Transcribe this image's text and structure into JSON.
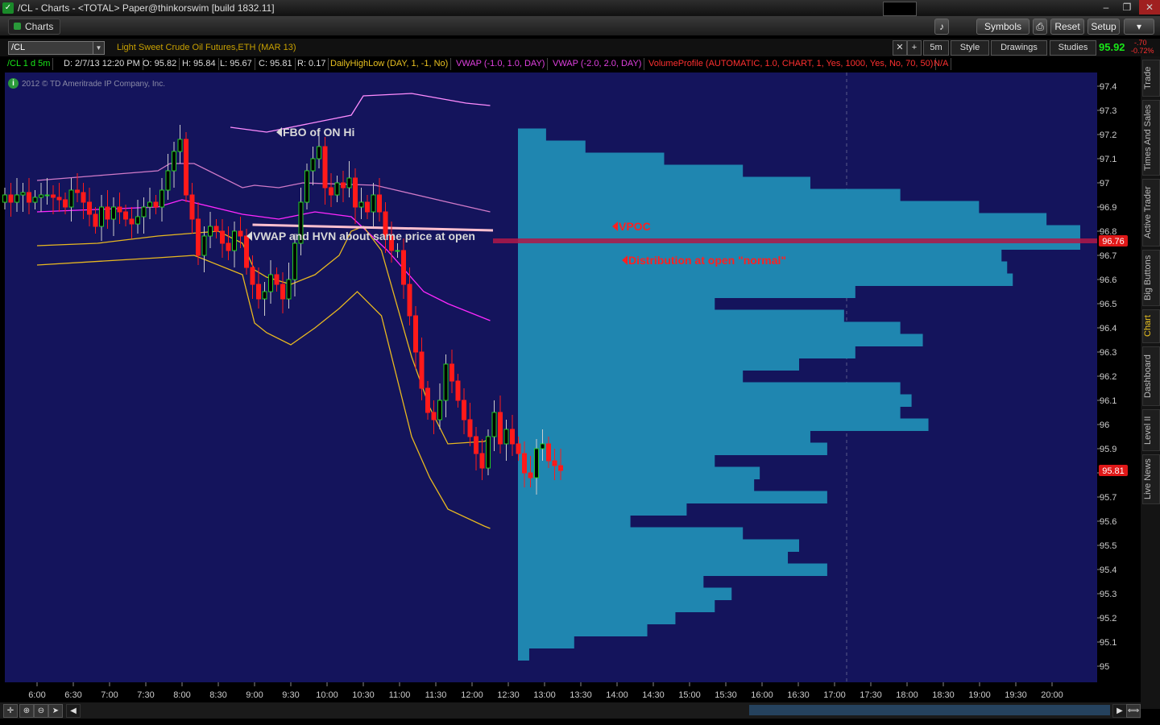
{
  "window": {
    "title": "/CL - Charts - <TOTAL> Paper@thinkorswim [build 1832.11]",
    "minimize": "–",
    "restore": "❐",
    "close": "✕"
  },
  "toolbar": {
    "charts_tab": "Charts",
    "symbols": "Symbols",
    "reset": "Reset",
    "setup": "Setup"
  },
  "chart_header": {
    "symbol": "/CL",
    "description": "Light Sweet Crude Oil Futures,ETH (MAR 13)",
    "interval": "5m",
    "style": "Style",
    "drawings": "Drawings",
    "studies": "Studies",
    "last_price": "95.92",
    "change": "-.70",
    "change_pct": "-0.72%"
  },
  "info_bar": {
    "period": "/CL 1 d 5m",
    "date": "D: 2/7/13 12:20 PM",
    "open": "O: 95.82",
    "high": "H: 95.84",
    "low": "L: 95.67",
    "close": "C: 95.81",
    "range": "R: 0.17",
    "study1": "DailyHighLow (DAY, 1, -1, No)",
    "study2": "VWAP (-1.0, 1.0, DAY)",
    "study3": "VWAP (-2.0, 2.0, DAY)",
    "study4": "VolumeProfile (AUTOMATIC, 1.0, CHART, 1, Yes, 1000, Yes, No, 70, 50)",
    "study5": "N/A"
  },
  "copyright": "2012 © TD Ameritrade IP Company, Inc.",
  "side_tabs": [
    "Trade",
    "Times And Sales",
    "Active Trader",
    "Big Buttons",
    "Chart",
    "Dashboard",
    "Level II",
    "Live News"
  ],
  "chart_data": {
    "type": "candlestick",
    "title": "",
    "ylim": [
      94.98,
      97.43
    ],
    "y_ticks": [
      "97.4",
      "97.3",
      "97.2",
      "97.1",
      "97",
      "96.9",
      "96.8",
      "96.7",
      "96.6",
      "96.5",
      "96.4",
      "96.3",
      "96.2",
      "96.1",
      "96",
      "95.9",
      "95.8",
      "95.7",
      "95.6",
      "95.5",
      "95.4",
      "95.3",
      "95.2",
      "95.1",
      "95"
    ],
    "x_ticks": [
      "6:00",
      "6:30",
      "7:00",
      "7:30",
      "8:00",
      "8:30",
      "9:00",
      "9:30",
      "10:00",
      "10:30",
      "11:00",
      "11:30",
      "12:00",
      "12:30",
      "13:00",
      "13:30",
      "14:00",
      "14:30",
      "15:00",
      "15:30",
      "16:00",
      "16:30",
      "17:00",
      "17:30",
      "18:00",
      "18:30",
      "19:00",
      "19:30",
      "20:00"
    ],
    "time_start": "6:00",
    "bar_minutes": 5,
    "current_price_label": "96.76",
    "last_price_label": "95.81",
    "closes": [
      96.95,
      96.92,
      96.95,
      96.96,
      96.92,
      96.94,
      96.95,
      96.95,
      96.94,
      96.93,
      96.9,
      96.97,
      96.96,
      96.92,
      96.87,
      96.82,
      96.9,
      96.85,
      96.9,
      96.88,
      96.85,
      96.83,
      96.86,
      96.9,
      96.92,
      96.9,
      96.97,
      97.05,
      97.13,
      97.18,
      96.95,
      96.85,
      96.7,
      96.78,
      96.82,
      96.8,
      96.75,
      96.72,
      96.8,
      96.78,
      96.65,
      96.58,
      96.52,
      96.55,
      96.62,
      96.58,
      96.52,
      96.6,
      96.75,
      96.92,
      97.05,
      97.1,
      97.15,
      96.98,
      96.95,
      97.0,
      96.98,
      97.02,
      96.9,
      96.92,
      96.88,
      96.95,
      96.88,
      96.78,
      96.72,
      96.72,
      96.58,
      96.45,
      96.3,
      96.15,
      96.05,
      96.02,
      96.1,
      96.25,
      96.18,
      96.1,
      96.02,
      95.95,
      95.88,
      95.82,
      95.95,
      96.05,
      95.92,
      95.98,
      95.92,
      95.88,
      95.8,
      95.78,
      95.9,
      95.92,
      95.85,
      95.83,
      95.81
    ],
    "series": [
      {
        "name": "",
        "color": "#ff8cff",
        "values": [
          [
            32,
            97.23
          ],
          [
            38,
            97.21
          ],
          [
            52,
            97.28
          ],
          [
            54,
            97.36
          ],
          [
            62,
            97.37
          ],
          [
            71,
            97.33
          ],
          [
            75,
            97.32
          ]
        ]
      },
      {
        "name": "",
        "color": "#d07ac8",
        "values": [
          [
            0,
            97.01
          ],
          [
            10,
            97.03
          ],
          [
            20,
            97.05
          ],
          [
            22,
            97.08
          ],
          [
            26,
            97.08
          ],
          [
            34,
            96.98
          ],
          [
            36,
            96.99
          ],
          [
            40,
            96.98
          ],
          [
            44,
            97.0
          ],
          [
            56,
            96.99
          ],
          [
            68,
            96.92
          ],
          [
            75,
            96.88
          ]
        ]
      },
      {
        "name": "",
        "color": "#ff28ff",
        "values": [
          [
            0,
            96.88
          ],
          [
            10,
            96.89
          ],
          [
            20,
            96.9
          ],
          [
            24,
            96.93
          ],
          [
            34,
            96.87
          ],
          [
            40,
            96.85
          ],
          [
            46,
            96.88
          ],
          [
            52,
            96.86
          ],
          [
            58,
            96.72
          ],
          [
            64,
            96.55
          ],
          [
            68,
            96.5
          ],
          [
            75,
            96.43
          ]
        ]
      },
      {
        "name": "",
        "color": "#e8b820",
        "values": [
          [
            0,
            96.74
          ],
          [
            10,
            96.75
          ],
          [
            20,
            96.78
          ],
          [
            30,
            96.8
          ],
          [
            34,
            96.75
          ],
          [
            36,
            96.64
          ],
          [
            38,
            96.61
          ],
          [
            42,
            96.58
          ],
          [
            46,
            96.62
          ],
          [
            50,
            96.7
          ],
          [
            52,
            96.8
          ],
          [
            54,
            96.82
          ],
          [
            57,
            96.72
          ],
          [
            62,
            96.28
          ],
          [
            65,
            96.07
          ],
          [
            68,
            95.92
          ],
          [
            74,
            95.93
          ],
          [
            75,
            95.94
          ]
        ]
      },
      {
        "name": "",
        "color": "#e8b820",
        "values": [
          [
            0,
            96.66
          ],
          [
            20,
            96.69
          ],
          [
            26,
            96.7
          ],
          [
            34,
            96.62
          ],
          [
            36,
            96.42
          ],
          [
            38,
            96.38
          ],
          [
            42,
            96.33
          ],
          [
            46,
            96.4
          ],
          [
            50,
            96.48
          ],
          [
            53,
            96.55
          ],
          [
            57,
            96.45
          ],
          [
            62,
            95.95
          ],
          [
            65,
            95.78
          ],
          [
            68,
            95.65
          ],
          [
            74,
            95.58
          ],
          [
            75,
            95.57
          ]
        ]
      }
    ],
    "hline": {
      "value": 96.76,
      "color": "#ff2a70"
    },
    "pink_line": {
      "value": 96.81,
      "from_bar": 29,
      "to_bar": 75
    },
    "volume_profile": {
      "price_step": 0.05,
      "volume": [
        [
          95.05,
          2
        ],
        [
          95.1,
          10
        ],
        [
          95.15,
          23
        ],
        [
          95.2,
          28
        ],
        [
          95.25,
          35
        ],
        [
          95.3,
          38
        ],
        [
          95.35,
          33
        ],
        [
          95.4,
          55
        ],
        [
          95.45,
          48
        ],
        [
          95.5,
          50
        ],
        [
          95.55,
          40
        ],
        [
          95.6,
          20
        ],
        [
          95.65,
          30
        ],
        [
          95.7,
          55
        ],
        [
          95.75,
          42
        ],
        [
          95.8,
          43
        ],
        [
          95.85,
          35
        ],
        [
          95.9,
          55
        ],
        [
          95.95,
          52
        ],
        [
          96.0,
          73
        ],
        [
          96.05,
          68
        ],
        [
          96.1,
          70
        ],
        [
          96.15,
          68
        ],
        [
          96.2,
          40
        ],
        [
          96.25,
          50
        ],
        [
          96.3,
          60
        ],
        [
          96.35,
          72
        ],
        [
          96.4,
          68
        ],
        [
          96.45,
          58
        ],
        [
          96.5,
          35
        ],
        [
          96.55,
          60
        ],
        [
          96.6,
          88
        ],
        [
          96.65,
          87
        ],
        [
          96.7,
          86
        ],
        [
          96.75,
          100
        ],
        [
          96.8,
          100
        ],
        [
          96.85,
          94
        ],
        [
          96.9,
          82
        ],
        [
          96.95,
          68
        ],
        [
          97.0,
          52
        ],
        [
          97.05,
          40
        ],
        [
          97.1,
          26
        ],
        [
          97.15,
          12
        ],
        [
          97.2,
          5
        ],
        [
          97.25,
          0
        ]
      ]
    },
    "annotations": [
      {
        "text": "FBO of ON Hi",
        "price": 97.21,
        "bar": 56,
        "color": "#d8d8d8"
      },
      {
        "text": "VWAP and HVN about same price at open",
        "price": 96.78,
        "bar": 50,
        "color": "#d8d8d8"
      },
      {
        "text": "VPOC",
        "price": 96.82,
        "bar": 126,
        "color": "#ff2020"
      },
      {
        "text": "Distribution at open \"normal\"",
        "price": 96.68,
        "bar": 128,
        "color": "#ff2020"
      }
    ]
  }
}
